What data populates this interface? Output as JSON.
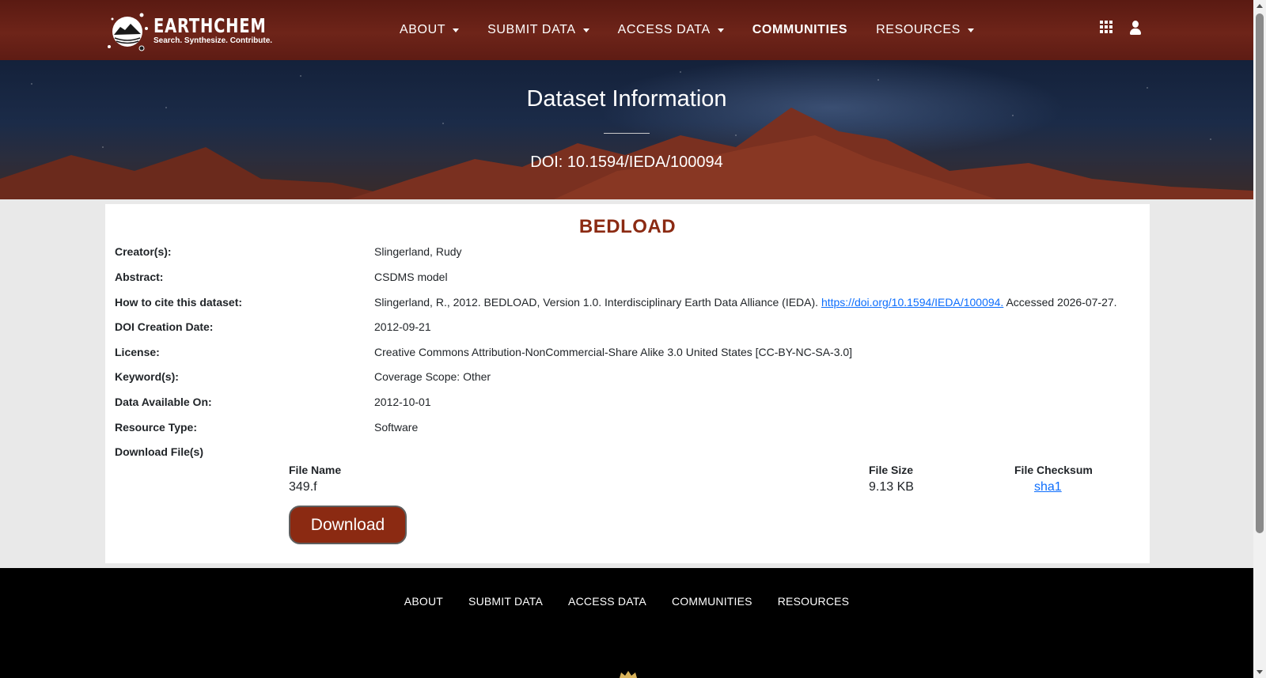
{
  "navbar": {
    "brand_name": "EARTHCHEM",
    "brand_tagline": "Search. Synthesize. Contribute.",
    "items": [
      {
        "label": "ABOUT",
        "dropdown": true
      },
      {
        "label": "SUBMIT DATA",
        "dropdown": true
      },
      {
        "label": "ACCESS DATA",
        "dropdown": true
      },
      {
        "label": "COMMUNITIES",
        "dropdown": false
      },
      {
        "label": "RESOURCES",
        "dropdown": true
      }
    ],
    "icons": [
      "apps-grid-icon",
      "user-icon"
    ]
  },
  "hero": {
    "title": "Dataset Information",
    "doi": "DOI: 10.1594/IEDA/100094"
  },
  "dataset": {
    "title": "BEDLOAD",
    "fields": {
      "creators": {
        "label": "Creator(s):",
        "value": "Slingerland, Rudy"
      },
      "abstract": {
        "label": "Abstract:",
        "value": "CSDMS model"
      },
      "citation": {
        "label": "How to cite this dataset:",
        "text_before": "Slingerland, R., 2012. BEDLOAD, Version 1.0. Interdisciplinary Earth Data Alliance (IEDA).",
        "link": "https://doi.org/10.1594/IEDA/100094.",
        "text_after": "Accessed 2026-07-27."
      },
      "doi_date": {
        "label": "DOI Creation Date:",
        "value": "2012-09-21"
      },
      "license": {
        "label": "License:",
        "value": "Creative Commons Attribution-NonCommercial-Share Alike 3.0 United States [CC-BY-NC-SA-3.0]"
      },
      "keywords": {
        "label": "Keyword(s):",
        "value": "Coverage Scope: Other"
      },
      "available_on": {
        "label": "Data Available On:",
        "value": "2012-10-01"
      },
      "resource_type": {
        "label": "Resource Type:",
        "value": "Software"
      }
    },
    "downloads": {
      "label": "Download File(s)",
      "headers": {
        "name": "File Name",
        "size": "File Size",
        "checksum": "File Checksum"
      },
      "files": [
        {
          "name": "349.f",
          "size": "9.13 KB",
          "checksum": "sha1"
        }
      ],
      "button_label": "Download"
    }
  },
  "footer": {
    "links": [
      "ABOUT",
      "SUBMIT DATA",
      "ACCESS DATA",
      "COMMUNITIES",
      "RESOURCES"
    ]
  },
  "colors": {
    "navbar": "#6e2419",
    "accent": "#8b2a12",
    "link": "#0d6efd",
    "footer": "#000000"
  }
}
